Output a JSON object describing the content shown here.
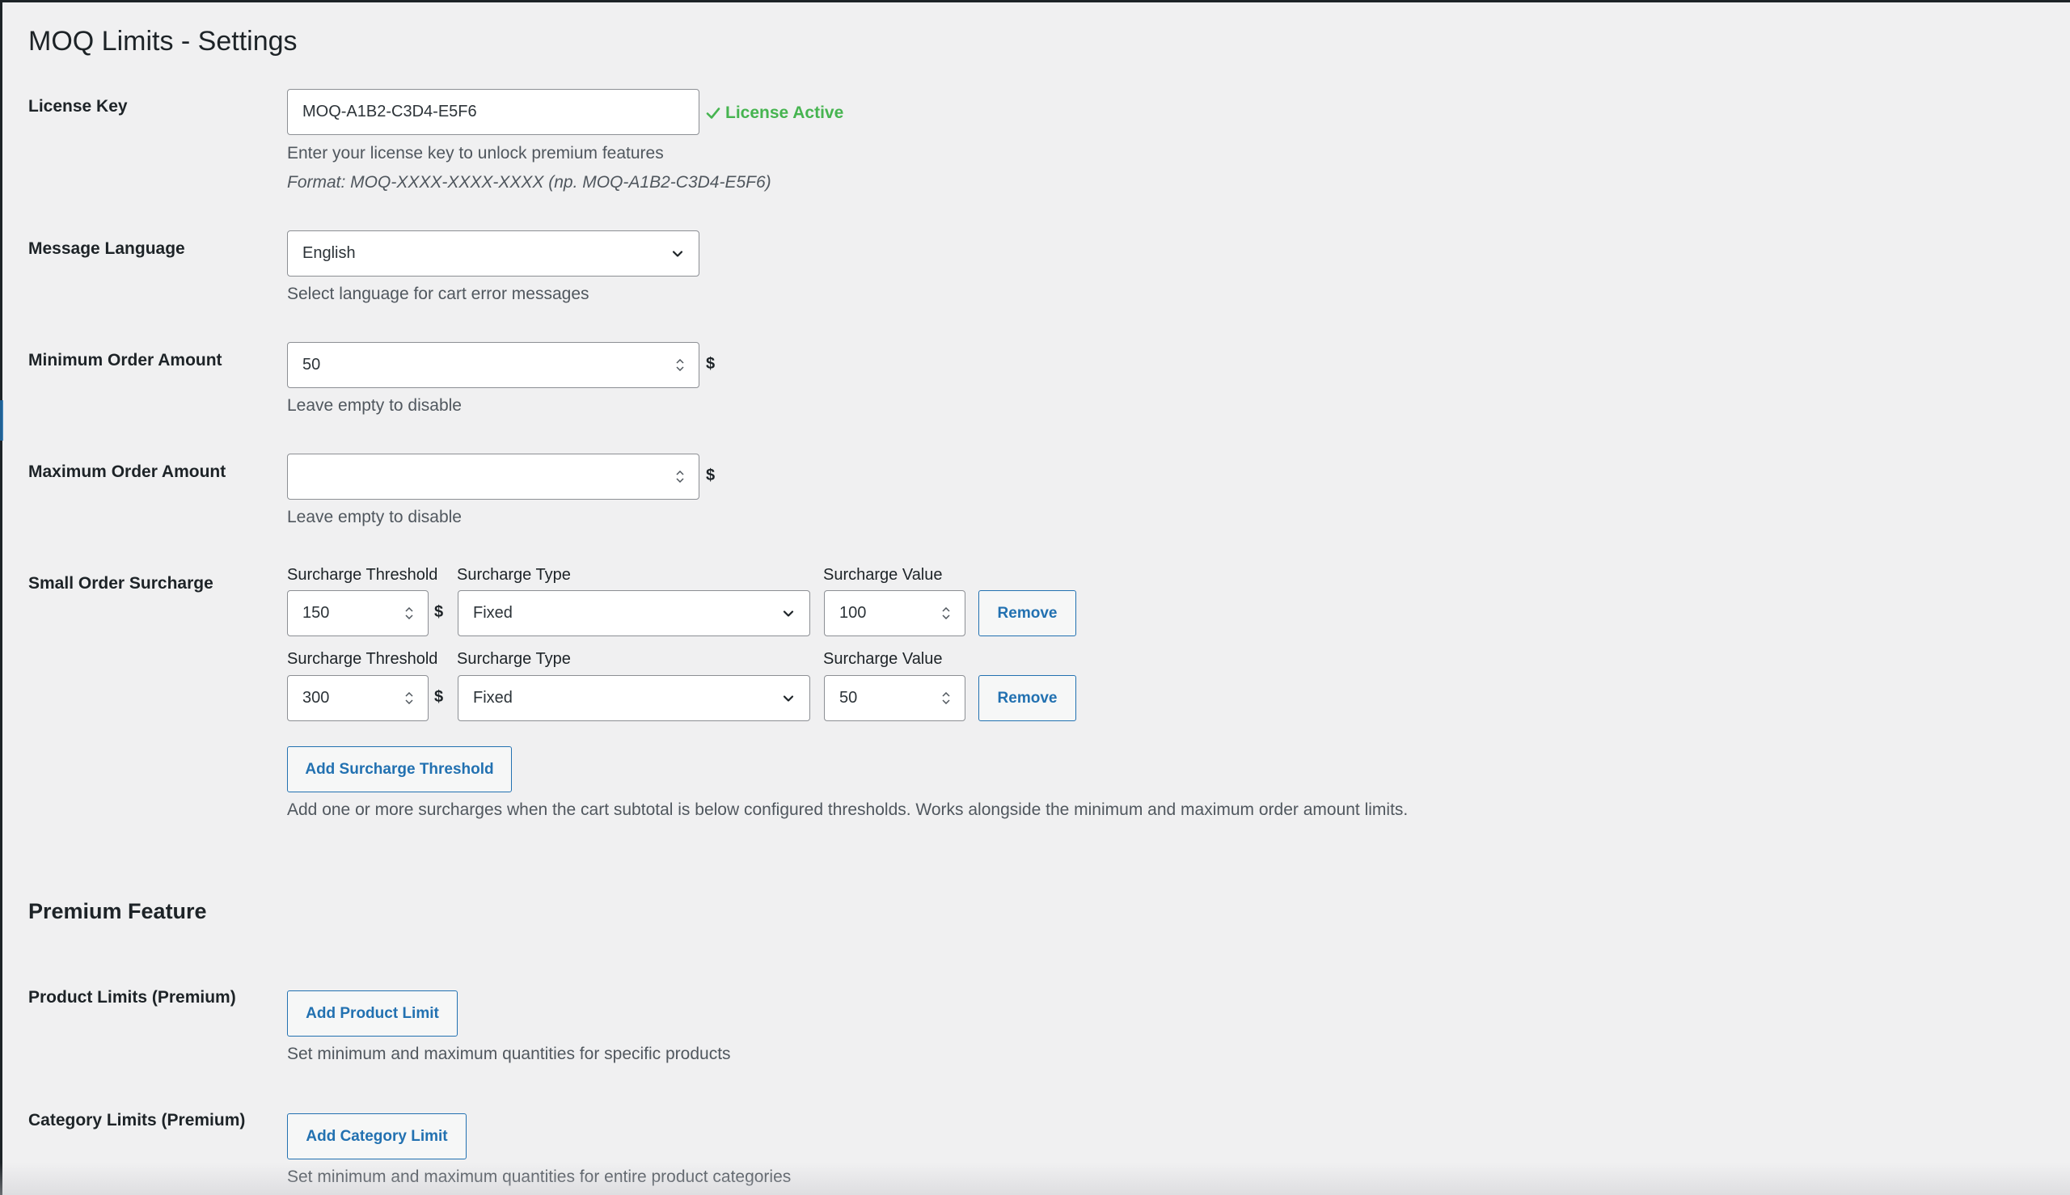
{
  "page": {
    "title": "MOQ Limits - Settings"
  },
  "license": {
    "label": "License Key",
    "value": "MOQ-A1B2-C3D4-E5F6",
    "status": "License Active",
    "status_color": "#46b450",
    "help": "Enter your license key to unlock premium features",
    "format": "Format: MOQ-XXXX-XXXX-XXXX (np. MOQ-A1B2-C3D4-E5F6)"
  },
  "language": {
    "label": "Message Language",
    "selected": "English",
    "help": "Select language for cart error messages"
  },
  "min_order": {
    "label": "Minimum Order Amount",
    "value": "50",
    "currency": "$",
    "help": "Leave empty to disable"
  },
  "max_order": {
    "label": "Maximum Order Amount",
    "value": "",
    "currency": "$",
    "help": "Leave empty to disable"
  },
  "surcharge": {
    "label": "Small Order Surcharge",
    "threshold_label": "Surcharge Threshold",
    "type_label": "Surcharge Type",
    "value_label": "Surcharge Value",
    "currency": "$",
    "remove_label": "Remove",
    "rows": [
      {
        "threshold": "150",
        "type": "Fixed",
        "value": "100"
      },
      {
        "threshold": "300",
        "type": "Fixed",
        "value": "50"
      }
    ],
    "add_label": "Add Surcharge Threshold",
    "help": "Add one or more surcharges when the cart subtotal is below configured thresholds. Works alongside the minimum and maximum order amount limits."
  },
  "premium": {
    "heading": "Premium Feature",
    "product": {
      "label": "Product Limits (Premium)",
      "button": "Add Product Limit",
      "help": "Set minimum and maximum quantities for specific products"
    },
    "category": {
      "label": "Category Limits (Premium)",
      "button": "Add Category Limit",
      "help": "Set minimum and maximum quantities for entire product categories"
    }
  },
  "colors": {
    "accent": "#2271b1",
    "success": "#46b450",
    "background": "#f0f0f1"
  }
}
